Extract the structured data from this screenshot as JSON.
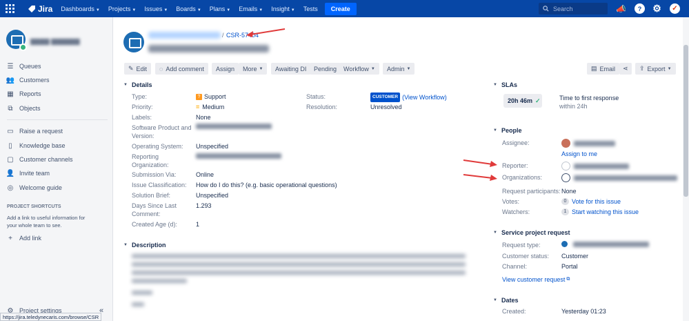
{
  "topnav": {
    "logo": "Jira",
    "items": [
      "Dashboards",
      "Projects",
      "Issues",
      "Boards",
      "Plans",
      "Emails",
      "Insight",
      "Tests"
    ],
    "create": "Create",
    "search_placeholder": "Search"
  },
  "sidebar": {
    "items": [
      "Queues",
      "Customers",
      "Reports",
      "Objects"
    ],
    "items2": [
      "Raise a request",
      "Knowledge base",
      "Customer channels",
      "Invite team",
      "Welcome guide"
    ],
    "shortcuts_title": "PROJECT SHORTCUTS",
    "shortcuts_text": "Add a link to useful information for your whole team to see.",
    "add_link": "Add link",
    "project_settings": "Project settings"
  },
  "status_url": "https://jira.teledynecaris.com/browse/CSR",
  "issue": {
    "breadcrumb_sep": "/",
    "key": "CSR-57404"
  },
  "toolbar": {
    "edit": "Edit",
    "add_comment": "Add comment",
    "assign": "Assign",
    "more": "More",
    "awaiting": "Awaiting DI",
    "pending": "Pending",
    "workflow": "Workflow",
    "admin": "Admin",
    "email": "Email",
    "export": "Export"
  },
  "details": {
    "title": "Details",
    "type_label": "Type:",
    "type_value": "Support",
    "priority_label": "Priority:",
    "priority_value": "Medium",
    "labels_label": "Labels:",
    "labels_value": "None",
    "software_label": "Software Product and Version:",
    "os_label": "Operating System:",
    "os_value": "Unspecified",
    "reporting_label": "Reporting Organization:",
    "submission_label": "Submission Via:",
    "submission_value": "Online",
    "classification_label": "Issue Classification:",
    "classification_value": "How do I do this? (e.g. basic operational questions)",
    "solution_label": "Solution Brief:",
    "solution_value": "Unspecified",
    "days_label": "Days Since Last Comment:",
    "days_value": "1.293",
    "created_age_label": "Created Age (d):",
    "created_age_value": "1",
    "status_label": "Status:",
    "status_badge": "CUSTOMER",
    "status_link": "(View Workflow)",
    "resolution_label": "Resolution:",
    "resolution_value": "Unresolved"
  },
  "description": {
    "title": "Description"
  },
  "slas": {
    "title": "SLAs",
    "time": "20h 46m",
    "name": "Time to first response",
    "sub": "within 24h"
  },
  "people": {
    "title": "People",
    "assignee_label": "Assignee:",
    "assign_to_me": "Assign to me",
    "reporter_label": "Reporter:",
    "organizations_label": "Organizations:",
    "participants_label": "Request participants:",
    "participants_value": "None",
    "votes_label": "Votes:",
    "votes_count": "0",
    "votes_link": "Vote for this issue",
    "watchers_label": "Watchers:",
    "watchers_count": "1",
    "watchers_link": "Start watching this issue"
  },
  "service": {
    "title": "Service project request",
    "type_label": "Request type:",
    "status_label": "Customer status:",
    "status_value": "Customer",
    "channel_label": "Channel:",
    "channel_value": "Portal",
    "view_link": "View customer request"
  },
  "dates": {
    "title": "Dates",
    "created_label": "Created:",
    "created_value": "Yesterday 01:23"
  }
}
